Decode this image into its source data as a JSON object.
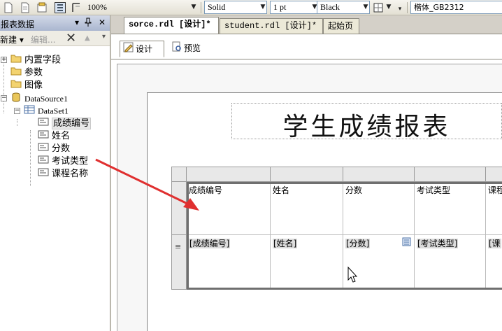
{
  "toolbar": {
    "zoom": "100%",
    "line_style": "Solid",
    "line_width": "1 pt",
    "line_color": "Black",
    "font_name": "楷体_GB2312"
  },
  "left_panel": {
    "title": "报表数据",
    "pin": "▾ ᵖ",
    "close": "✕",
    "new_label": "新建",
    "edit_label": "编辑..."
  },
  "tree": {
    "builtin_fields": "内置字段",
    "parameters": "参数",
    "images": "图像",
    "datasource": "DataSource1",
    "dataset": "DataSet1",
    "fields": [
      "成绩编号",
      "姓名",
      "分数",
      "考试类型",
      "课程名称"
    ]
  },
  "tabs": {
    "doc_tabs": [
      "sorce.rdl [设计]*",
      "student.rdl [设计]*",
      "起始页"
    ],
    "sub_tabs": [
      "设计",
      "预览"
    ]
  },
  "report": {
    "title": "学生成绩报表",
    "headers": [
      "成绩编号",
      "姓名",
      "分数",
      "考试类型",
      "课程"
    ],
    "details": [
      "[成绩编号]",
      "[姓名]",
      "[分数]",
      "[考试类型]",
      "[课"
    ]
  },
  "colors": {
    "arrow": "#e03030",
    "header_gradient": "#aab6cf",
    "table_frame": "#6f6f6f"
  },
  "icons": [
    "new-icon",
    "open-icon",
    "properties-icon",
    "line-icon",
    "border-icon",
    "folder-icon",
    "datasource-icon",
    "dataset-icon",
    "field-icon",
    "design-icon",
    "preview-icon",
    "mouse-cursor-icon"
  ]
}
